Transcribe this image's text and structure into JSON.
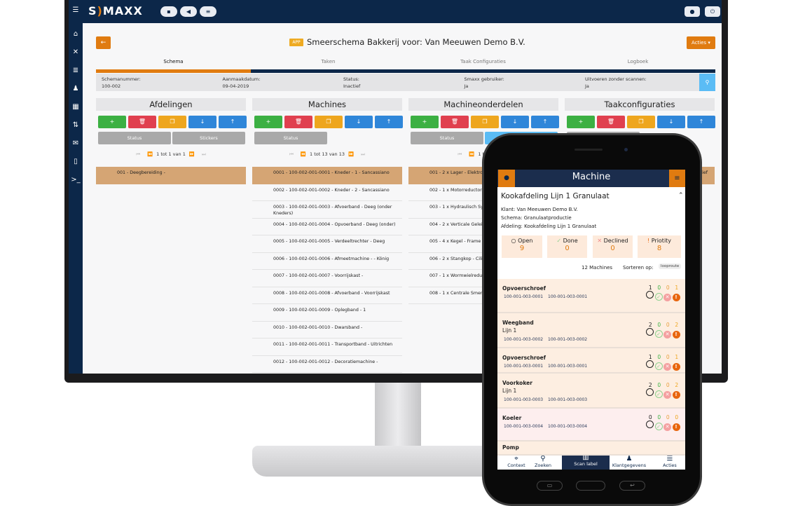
{
  "desktop": {
    "logo": "SMAXX",
    "topbar_icons": [
      "clipboard-icon",
      "megaphone-icon",
      "sliders-icon"
    ],
    "topbar_right_icons": [
      "user-icon",
      "logout-icon"
    ],
    "sidebar_icons": [
      "menu-icon",
      "home-icon",
      "tools-icon",
      "database-icon",
      "users-icon",
      "qrcode-icon",
      "transfer-icon",
      "mail-icon",
      "mobile-icon",
      "terminal-icon"
    ],
    "back_label": "←",
    "app_badge": "APP",
    "title": "Smeerschema Bakkerij voor: Van Meeuwen Demo B.V.",
    "acties_label": "Acties ▾",
    "tabs": [
      {
        "label": "Schema",
        "active": true
      },
      {
        "label": "Taken"
      },
      {
        "label": "Taak Configuraties"
      },
      {
        "label": "Logboek"
      }
    ],
    "info": [
      {
        "label": "Schemanummer:",
        "value": "100-002"
      },
      {
        "label": "Aanmaakdatum:",
        "value": "09-04-2019"
      },
      {
        "label": "Status:",
        "value": "Inactief"
      },
      {
        "label": "Smaxx gebruiker:",
        "value": "Ja"
      },
      {
        "label": "Uitvoeren zonder scannen:",
        "value": "Ja"
      }
    ],
    "action_buttons": [
      {
        "icon": "+",
        "name": "add",
        "color": "#3cb043"
      },
      {
        "icon": "🗑",
        "name": "delete",
        "color": "#e0404f"
      },
      {
        "icon": "❐",
        "name": "copy",
        "color": "#eea61e"
      },
      {
        "icon": "↓",
        "name": "move-down",
        "color": "#2f86d9"
      },
      {
        "icon": "↑",
        "name": "move-up",
        "color": "#2f86d9"
      }
    ],
    "columns": [
      {
        "title": "Afdelingen",
        "buttons": [
          "Status",
          "Stickers"
        ],
        "pagination": "1 tot 1 van 1",
        "rows": [
          "001 - Deegbereiding -"
        ]
      },
      {
        "title": "Machines",
        "buttons": [
          "Status"
        ],
        "pagination": "1 tot 13 van 13",
        "rows": [
          "0001 - 100-002-001-0001 - Kneder - 1 - Sancassiano",
          "0002 - 100-002-001-0002 - Kneder - 2 - Sancassiano",
          "0003 - 100-002-001-0003 - Afvoerband - Deeg (onder Kneders)",
          "0004 - 100-002-001-0004 - Opvoerband - Deeg (onder)",
          "0005 - 100-002-001-0005 - Verdeeltrechter - Deeg",
          "0006 - 100-002-001-0006 - Afmeetmachine -  - König",
          "0007 - 100-002-001-0007 - Voorrijskast -",
          "0008 - 100-002-001-0008 - Afvoerband - Voorrijskast",
          "0009 - 100-002-001-0009 - Oplegband - 1",
          "0010 - 100-002-001-0010 - Dwarsband -",
          "0011 - 100-002-001-0011 - Transportband - Uitrichten",
          "0012 - 100-002-001-0012 - Decoratiemachine -"
        ]
      },
      {
        "title": "Machineonderdelen",
        "buttons": [
          "Status",
          ""
        ],
        "pagination": "1 tot",
        "rows": [
          "001 - 2 x Lager - Elektromoto",
          "002 - 1 x Motorreductor - Hoo",
          "003 - 1 x Hydraulisch Systeem",
          "004 - 2 x Verticale Geleiding -",
          "005 - 4 x Kegel - Frame Heffer",
          "006 - 2 x Stangkop - Cilinder",
          "007 - 1 x Wormwielreductor -",
          "008 - 1 x Centrale Smering - L"
        ]
      },
      {
        "title": "Taakconfiguraties",
        "buttons": [
          ""
        ],
        "pagination": "",
        "rows": [
          "tief"
        ]
      }
    ]
  },
  "mobile": {
    "header_title": "Machine",
    "section_title": "Kookafdeling Lijn 1 Granulaat",
    "details": [
      "Klant: Van Meeuwen Demo B.V.",
      "Schema: Granulaatproductie",
      "Afdeling: Kookafdeling Lijn 1 Granulaat"
    ],
    "stats": [
      {
        "label": "Open",
        "value": "9",
        "icon": "circle-icon"
      },
      {
        "label": "Done",
        "value": "0",
        "icon": "check-circle-icon"
      },
      {
        "label": "Declined",
        "value": "0",
        "icon": "x-circle-icon"
      },
      {
        "label": "Priotity",
        "value": "8",
        "icon": "exclamation-circle-icon"
      }
    ],
    "machine_count": "12 Machines",
    "sort_label": "Sorteren op:",
    "sort_value": "looproute",
    "machines": [
      {
        "name": "Opvoerschroef",
        "sub": "",
        "codes": [
          "100-001-003-0001",
          "100-001-003-0001"
        ],
        "counts": [
          "1",
          "0",
          "0",
          "1"
        ]
      },
      {
        "name": "Weegband",
        "sub": "Lijn 1",
        "codes": [
          "100-001-003-0002",
          "100-001-003-0002"
        ],
        "counts": [
          "2",
          "0",
          "0",
          "2"
        ]
      },
      {
        "name": "Opvoerschroef",
        "sub": "",
        "codes": [
          "100-001-003-0001",
          "100-001-003-0001"
        ],
        "counts": [
          "1",
          "0",
          "0",
          "1"
        ]
      },
      {
        "name": "Voorkoker",
        "sub": "Lijn 1",
        "codes": [
          "100-001-003-0003",
          "100-001-003-0003"
        ],
        "counts": [
          "2",
          "0",
          "0",
          "2"
        ]
      },
      {
        "name": "Koeler",
        "sub": "",
        "codes": [
          "100-001-003-0004",
          "100-001-003-0004"
        ],
        "counts": [
          "0",
          "0",
          "0",
          "0"
        ]
      },
      {
        "name": "Pomp",
        "sub": "",
        "codes": [],
        "counts": []
      }
    ],
    "bottom_nav": [
      {
        "label": "Context",
        "icon": "crosshair-icon"
      },
      {
        "label": "Zoeken",
        "icon": "search-icon"
      },
      {
        "label": "Scan label",
        "icon": "barcode-icon",
        "active": true
      },
      {
        "label": "Klantgegevens",
        "icon": "user-icon"
      },
      {
        "label": "Acties",
        "icon": "list-icon"
      }
    ]
  },
  "colors": {
    "navy": "#0c2749",
    "orange": "#e07b10",
    "highlight": "#d5a574",
    "row_peach": "#fdeee1",
    "row_pink": "#fdeeee"
  }
}
